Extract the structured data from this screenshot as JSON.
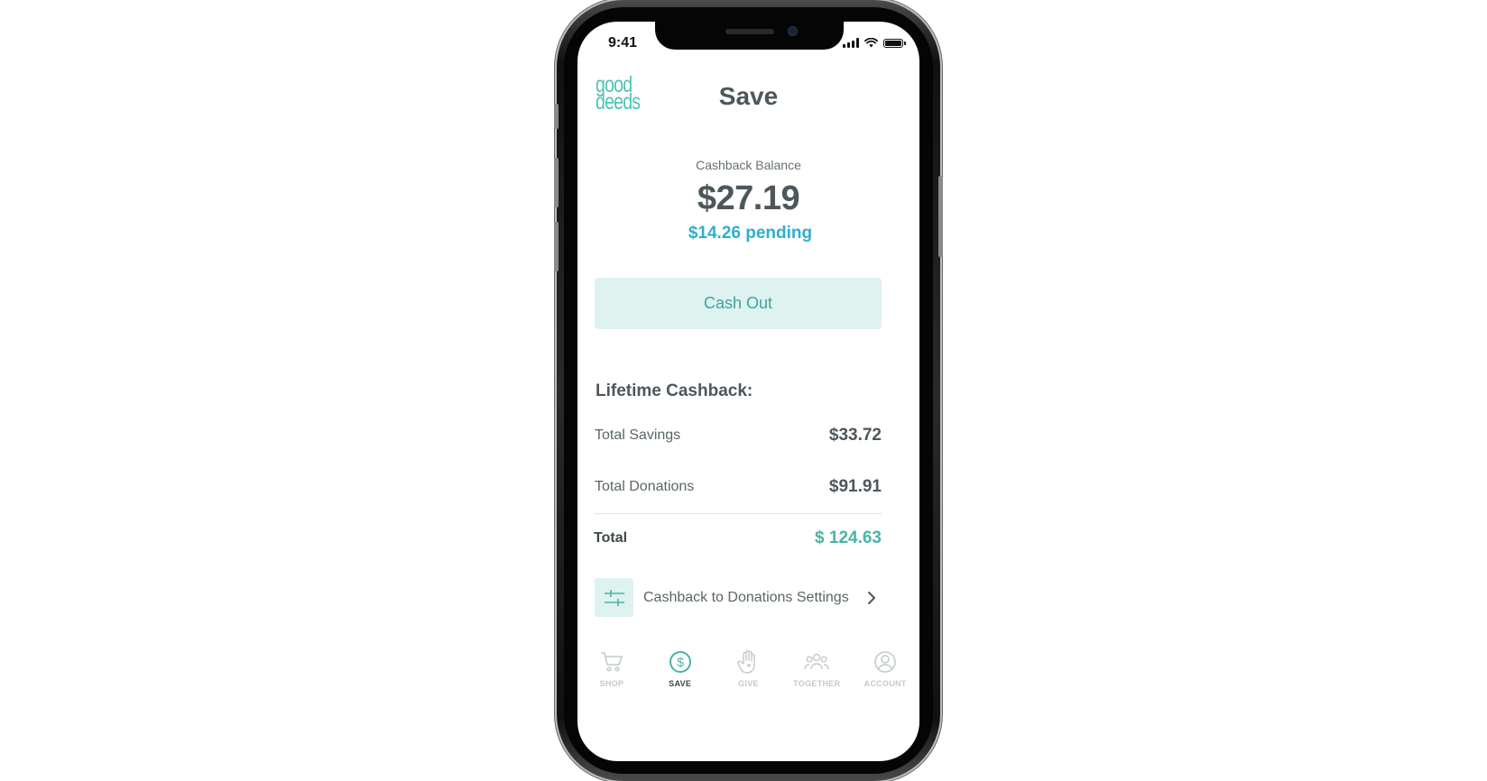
{
  "status_bar": {
    "time": "9:41"
  },
  "app": {
    "logo_line1": "good",
    "logo_line2": "deeds"
  },
  "header": {
    "title": "Save"
  },
  "balance": {
    "label": "Cashback Balance",
    "amount": "$27.19",
    "pending": "$14.26 pending"
  },
  "actions": {
    "cash_out_label": "Cash Out"
  },
  "lifetime": {
    "title": "Lifetime Cashback:",
    "rows": [
      {
        "label": "Total Savings",
        "value": "$33.72"
      },
      {
        "label": "Total Donations",
        "value": "$91.91"
      }
    ],
    "total": {
      "label": "Total",
      "value": "$ 124.63"
    }
  },
  "settings_link": {
    "label": "Cashback to Donations Settings",
    "icon": "sliders-icon"
  },
  "tabs": [
    {
      "label": "SHOP",
      "icon": "cart-icon",
      "active": false
    },
    {
      "label": "SAVE",
      "icon": "dollar-circle-icon",
      "active": true
    },
    {
      "label": "GIVE",
      "icon": "hand-icon",
      "active": false
    },
    {
      "label": "TOGETHER",
      "icon": "people-icon",
      "active": false
    },
    {
      "label": "ACCOUNT",
      "icon": "person-circle-icon",
      "active": false
    }
  ],
  "colors": {
    "accent": "#49b3a5",
    "accent_light": "#def2f0",
    "pending_blue": "#2eaed0",
    "text_dark": "#4d575b",
    "tab_inactive": "#c4c9cb"
  }
}
